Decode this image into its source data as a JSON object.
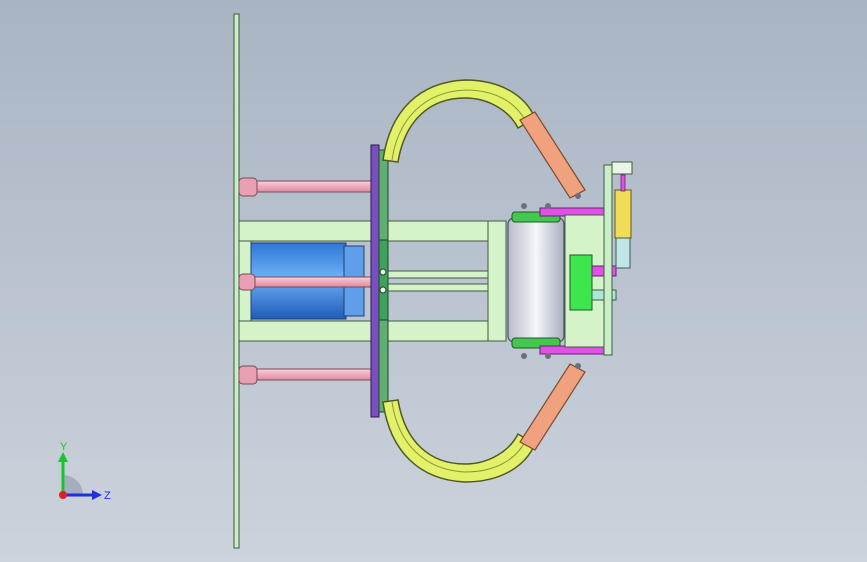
{
  "viewport": {
    "background_top": "#a9b4c3",
    "background_bottom": "#ccd3dc"
  },
  "colors": {
    "plate": "#c8efc8",
    "plate_edge": "#4f6a4f",
    "rod_pink": "#f2b6c6",
    "cylinder_blue": "#3f8fe6",
    "arm_yellow": "#e3f06a",
    "arm_orange": "#f0a27e",
    "frame_green": "#d4f3c9",
    "magenta": "#e052e6",
    "roller_gray": "#dfe3ee",
    "bright_green": "#3ee64e",
    "purple": "#6f3bb5"
  },
  "triad": {
    "y_label": "Y",
    "z_label": "Z",
    "y_color": "#19c42f",
    "z_color": "#1f2fe0",
    "x_color": "#e01f1f"
  }
}
